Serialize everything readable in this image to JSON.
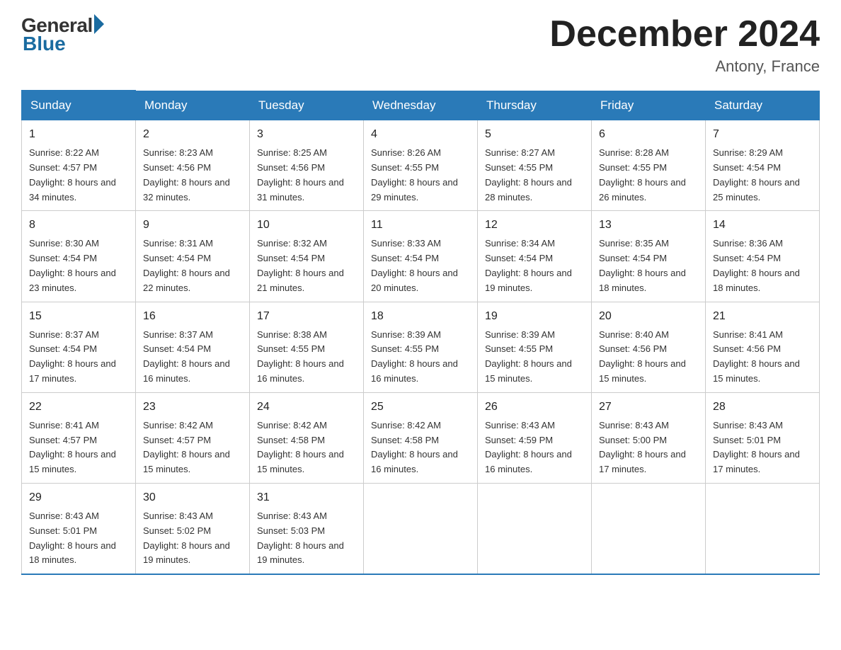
{
  "header": {
    "logo_general": "General",
    "logo_blue": "Blue",
    "month_title": "December 2024",
    "location": "Antony, France"
  },
  "days_of_week": [
    "Sunday",
    "Monday",
    "Tuesday",
    "Wednesday",
    "Thursday",
    "Friday",
    "Saturday"
  ],
  "weeks": [
    [
      {
        "day": "1",
        "sunrise": "8:22 AM",
        "sunset": "4:57 PM",
        "daylight": "8 hours and 34 minutes."
      },
      {
        "day": "2",
        "sunrise": "8:23 AM",
        "sunset": "4:56 PM",
        "daylight": "8 hours and 32 minutes."
      },
      {
        "day": "3",
        "sunrise": "8:25 AM",
        "sunset": "4:56 PM",
        "daylight": "8 hours and 31 minutes."
      },
      {
        "day": "4",
        "sunrise": "8:26 AM",
        "sunset": "4:55 PM",
        "daylight": "8 hours and 29 minutes."
      },
      {
        "day": "5",
        "sunrise": "8:27 AM",
        "sunset": "4:55 PM",
        "daylight": "8 hours and 28 minutes."
      },
      {
        "day": "6",
        "sunrise": "8:28 AM",
        "sunset": "4:55 PM",
        "daylight": "8 hours and 26 minutes."
      },
      {
        "day": "7",
        "sunrise": "8:29 AM",
        "sunset": "4:54 PM",
        "daylight": "8 hours and 25 minutes."
      }
    ],
    [
      {
        "day": "8",
        "sunrise": "8:30 AM",
        "sunset": "4:54 PM",
        "daylight": "8 hours and 23 minutes."
      },
      {
        "day": "9",
        "sunrise": "8:31 AM",
        "sunset": "4:54 PM",
        "daylight": "8 hours and 22 minutes."
      },
      {
        "day": "10",
        "sunrise": "8:32 AM",
        "sunset": "4:54 PM",
        "daylight": "8 hours and 21 minutes."
      },
      {
        "day": "11",
        "sunrise": "8:33 AM",
        "sunset": "4:54 PM",
        "daylight": "8 hours and 20 minutes."
      },
      {
        "day": "12",
        "sunrise": "8:34 AM",
        "sunset": "4:54 PM",
        "daylight": "8 hours and 19 minutes."
      },
      {
        "day": "13",
        "sunrise": "8:35 AM",
        "sunset": "4:54 PM",
        "daylight": "8 hours and 18 minutes."
      },
      {
        "day": "14",
        "sunrise": "8:36 AM",
        "sunset": "4:54 PM",
        "daylight": "8 hours and 18 minutes."
      }
    ],
    [
      {
        "day": "15",
        "sunrise": "8:37 AM",
        "sunset": "4:54 PM",
        "daylight": "8 hours and 17 minutes."
      },
      {
        "day": "16",
        "sunrise": "8:37 AM",
        "sunset": "4:54 PM",
        "daylight": "8 hours and 16 minutes."
      },
      {
        "day": "17",
        "sunrise": "8:38 AM",
        "sunset": "4:55 PM",
        "daylight": "8 hours and 16 minutes."
      },
      {
        "day": "18",
        "sunrise": "8:39 AM",
        "sunset": "4:55 PM",
        "daylight": "8 hours and 16 minutes."
      },
      {
        "day": "19",
        "sunrise": "8:39 AM",
        "sunset": "4:55 PM",
        "daylight": "8 hours and 15 minutes."
      },
      {
        "day": "20",
        "sunrise": "8:40 AM",
        "sunset": "4:56 PM",
        "daylight": "8 hours and 15 minutes."
      },
      {
        "day": "21",
        "sunrise": "8:41 AM",
        "sunset": "4:56 PM",
        "daylight": "8 hours and 15 minutes."
      }
    ],
    [
      {
        "day": "22",
        "sunrise": "8:41 AM",
        "sunset": "4:57 PM",
        "daylight": "8 hours and 15 minutes."
      },
      {
        "day": "23",
        "sunrise": "8:42 AM",
        "sunset": "4:57 PM",
        "daylight": "8 hours and 15 minutes."
      },
      {
        "day": "24",
        "sunrise": "8:42 AM",
        "sunset": "4:58 PM",
        "daylight": "8 hours and 15 minutes."
      },
      {
        "day": "25",
        "sunrise": "8:42 AM",
        "sunset": "4:58 PM",
        "daylight": "8 hours and 16 minutes."
      },
      {
        "day": "26",
        "sunrise": "8:43 AM",
        "sunset": "4:59 PM",
        "daylight": "8 hours and 16 minutes."
      },
      {
        "day": "27",
        "sunrise": "8:43 AM",
        "sunset": "5:00 PM",
        "daylight": "8 hours and 17 minutes."
      },
      {
        "day": "28",
        "sunrise": "8:43 AM",
        "sunset": "5:01 PM",
        "daylight": "8 hours and 17 minutes."
      }
    ],
    [
      {
        "day": "29",
        "sunrise": "8:43 AM",
        "sunset": "5:01 PM",
        "daylight": "8 hours and 18 minutes."
      },
      {
        "day": "30",
        "sunrise": "8:43 AM",
        "sunset": "5:02 PM",
        "daylight": "8 hours and 19 minutes."
      },
      {
        "day": "31",
        "sunrise": "8:43 AM",
        "sunset": "5:03 PM",
        "daylight": "8 hours and 19 minutes."
      },
      null,
      null,
      null,
      null
    ]
  ]
}
